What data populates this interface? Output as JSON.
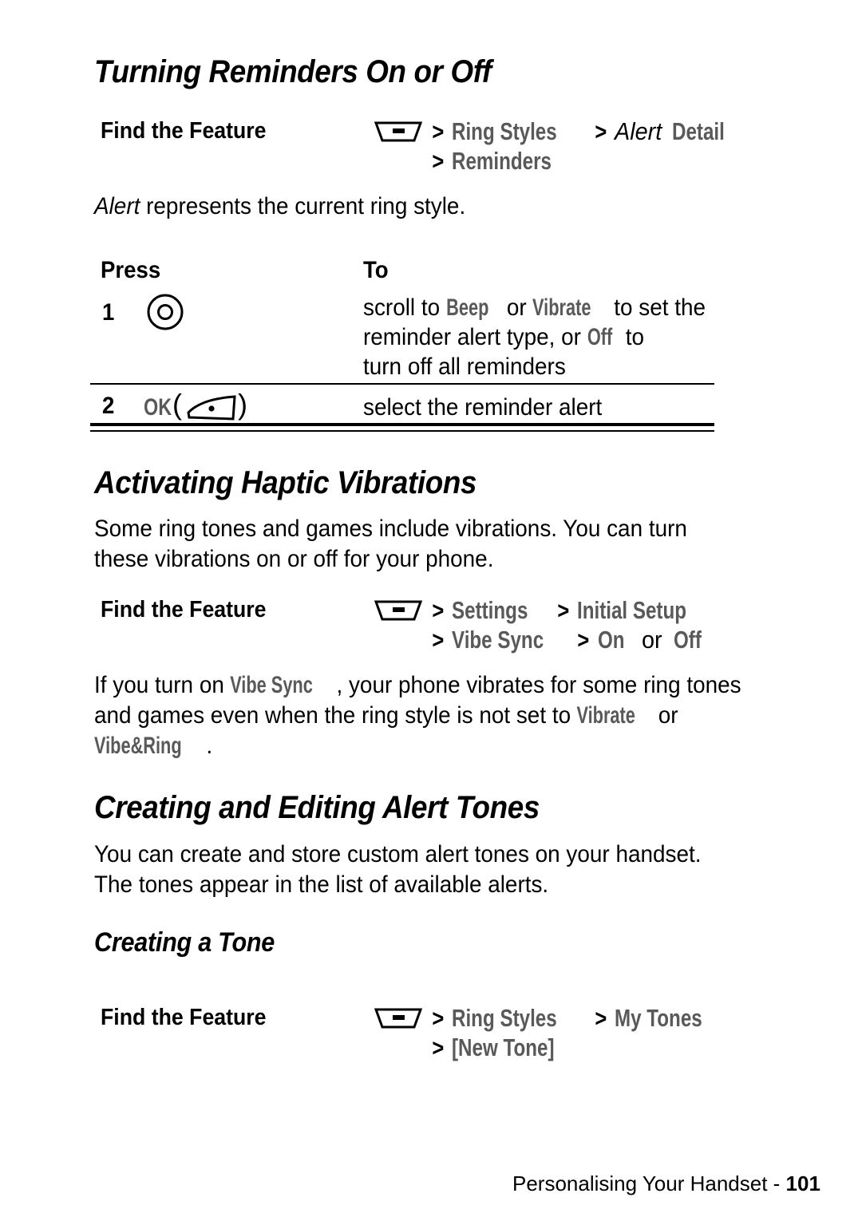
{
  "page": {
    "footer_text": "Personalising Your Handset - ",
    "footer_page": "101"
  },
  "sections": [
    {
      "id": "turning-reminders",
      "heading": "Turning Reminders On or Off",
      "find_the_feature_label": "Find the Feature",
      "menu_icon": "menu-key-icon",
      "path_line1": [
        {
          "text": ">",
          "style": "gt"
        },
        {
          "text": "Ring Styles",
          "style": "menu-gray"
        },
        {
          "text": ">",
          "style": "gt"
        },
        {
          "text": "Alert",
          "style": "italic-black"
        },
        {
          "text": "Detail",
          "style": "menu-gray"
        }
      ],
      "path_line2": [
        {
          "text": ">",
          "style": "gt"
        },
        {
          "text": "Reminders",
          "style": "menu-gray"
        }
      ],
      "note_italic": "Alert",
      "note_rest": " represents the current ring style.",
      "table": {
        "col_press": "Press",
        "col_to": "To",
        "rows": [
          {
            "num": "1",
            "key_icon": "scroll-key-icon",
            "key_label": "",
            "to_line1_a": "scroll to ",
            "to_line1_b": "Beep",
            "to_line1_c": " or ",
            "to_line1_d": "Vibrate",
            "to_line1_e": " to set the",
            "to_line2_a": "reminder alert type, or ",
            "to_line2_b": "Off",
            "to_line2_c": " to",
            "to_line3": "turn off all reminders"
          },
          {
            "num": "2",
            "key_icon": "ok-key-icon",
            "key_label": "OK",
            "to_line1": "select the reminder alert"
          }
        ]
      }
    },
    {
      "id": "haptic-vibrations",
      "heading": "Activating Haptic Vibrations",
      "intro_line1": "Some ring tones and games include vibrations. You can turn",
      "intro_line2": "these vibrations on or off for your phone.",
      "find_the_feature_label": "Find the Feature",
      "menu_icon": "menu-key-icon",
      "path_line1": [
        {
          "text": ">",
          "style": "gt"
        },
        {
          "text": "Settings",
          "style": "menu-gray"
        },
        {
          "text": ">",
          "style": "gt"
        },
        {
          "text": "Initial Setup",
          "style": "menu-gray"
        }
      ],
      "path_line2": [
        {
          "text": ">",
          "style": "gt"
        },
        {
          "text": "Vibe Sync",
          "style": "menu-gray"
        },
        {
          "text": ">",
          "style": "gt"
        },
        {
          "text": "On",
          "style": "menu-gray"
        },
        {
          "text": "or",
          "style": "plain-black"
        },
        {
          "text": "Off",
          "style": "menu-gray"
        }
      ],
      "body_p1_a": "If you turn on ",
      "body_p1_b": "Vibe Sync",
      "body_p1_c": ", your phone vibrates for some ring tones",
      "body_p2_a": "and games even when the ring style is not set to ",
      "body_p2_b": "Vibrate",
      "body_p2_c": " or",
      "body_p3_a": "Vibe&Ring",
      "body_p3_b": "."
    },
    {
      "id": "creating-editing-alert-tones",
      "heading": "Creating and Editing Alert Tones",
      "intro_line1": "You can create and store custom alert tones on your handset.",
      "intro_line2": "The tones appear in the list of available alerts.",
      "subheading": "Creating a Tone",
      "find_the_feature_label": "Find the Feature",
      "menu_icon": "menu-key-icon",
      "path_line1": [
        {
          "text": ">",
          "style": "gt"
        },
        {
          "text": "Ring Styles",
          "style": "menu-gray"
        },
        {
          "text": ">",
          "style": "gt"
        },
        {
          "text": "My Tones",
          "style": "menu-gray"
        }
      ],
      "path_line2": [
        {
          "text": ">",
          "style": "gt"
        },
        {
          "text": "[New Tone]",
          "style": "menu-gray"
        }
      ]
    }
  ],
  "colors": {
    "menu_label_gray": "#59595b",
    "text_black": "#000000",
    "page_background": "#ffffff"
  }
}
